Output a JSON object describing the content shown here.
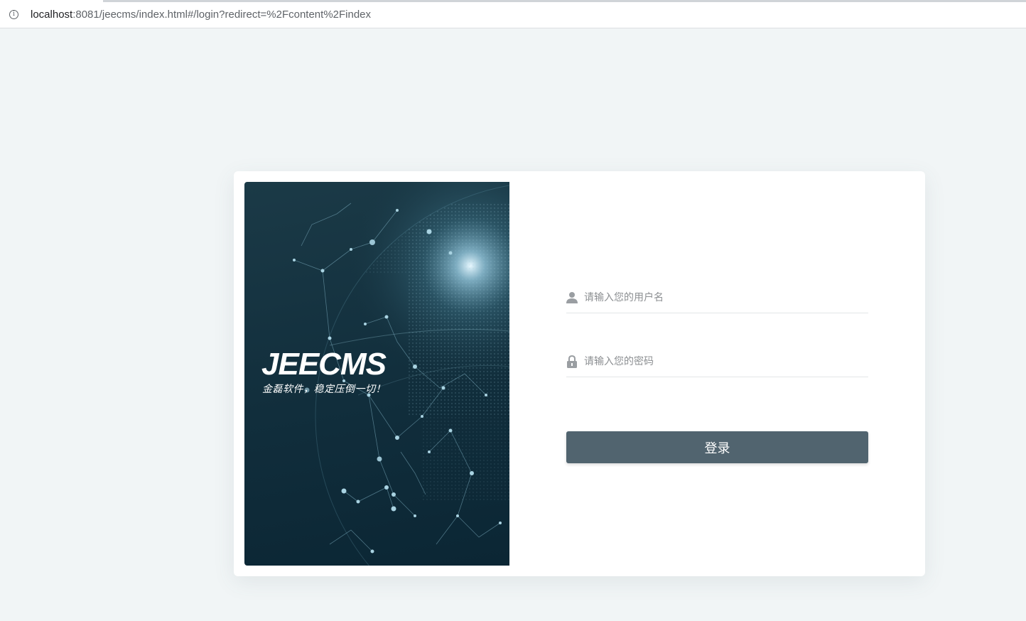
{
  "browser": {
    "url_host": "localhost",
    "url_rest": ":8081/jeecms/index.html#/login?redirect=%2Fcontent%2Findex",
    "info_symbol": "i"
  },
  "banner": {
    "brand": "JEECMS",
    "slogan": "金磊软件，稳定压倒一切！"
  },
  "form": {
    "username_placeholder": "请输入您的用户名",
    "username_value": "",
    "password_placeholder": "请输入您的密码",
    "password_value": "",
    "login_label": "登录"
  },
  "colors": {
    "page_background": "#f1f5f6",
    "banner_dark": "#112e3c",
    "button": "#51646f",
    "icon_gray": "#9a9ea2"
  },
  "icons": {
    "username": "user-icon",
    "password": "lock-icon",
    "site_info": "info-icon"
  }
}
